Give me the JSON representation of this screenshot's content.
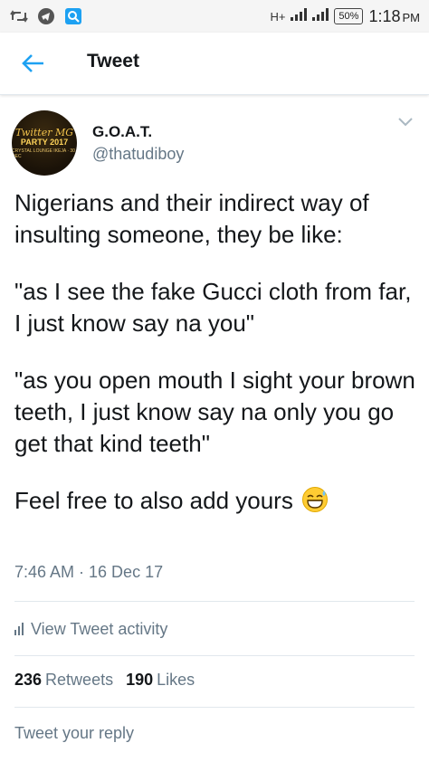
{
  "status_bar": {
    "signal_label": "H+",
    "battery": "50%",
    "time": "1:18",
    "ampm": "PM"
  },
  "header": {
    "title": "Tweet"
  },
  "tweet": {
    "avatar_text": {
      "line1": "Twitter MG",
      "line2": "PARTY 2017",
      "line3": "CRYSTAL LOUNGE IKEJA · 30 DEC"
    },
    "display_name": "G.O.A.T.",
    "handle": "@thatudiboy",
    "paragraphs": [
      "Nigerians and their indirect way of insulting someone, they be like:",
      "\"as I see the fake Gucci cloth from far, I just know say na you\"",
      "\"as you open mouth I sight your brown teeth, I just know say na only you go get that kind teeth\"",
      "Feel free to also add yours"
    ],
    "timestamp": "7:46 AM · 16 Dec 17"
  },
  "activity": {
    "label": "View Tweet activity"
  },
  "stats": {
    "retweets_count": "236",
    "retweets_label": "Retweets",
    "likes_count": "190",
    "likes_label": "Likes"
  },
  "reply": {
    "placeholder": "Tweet your reply"
  },
  "icons": {
    "accent": "#1da1f2",
    "emoji": "grinning-face-with-sweat-icon"
  }
}
